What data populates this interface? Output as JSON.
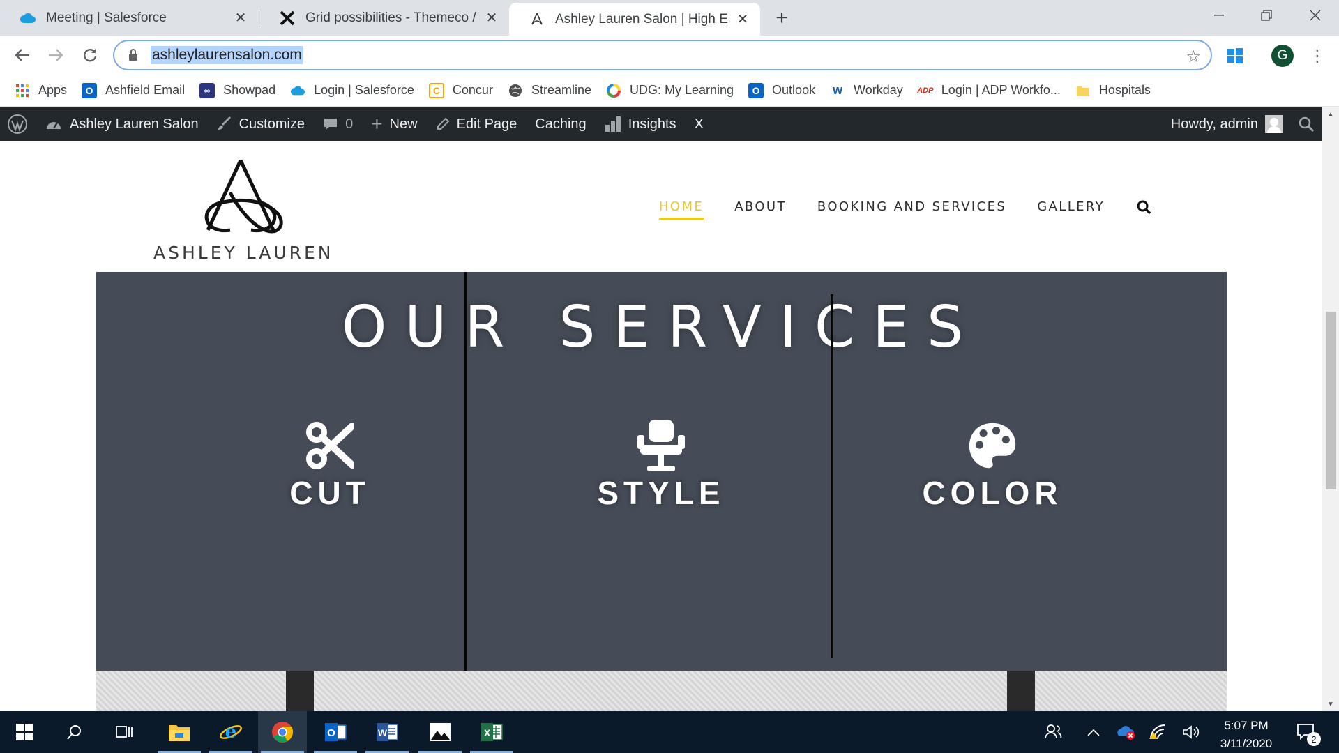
{
  "browser": {
    "tabs": [
      {
        "title": "Meeting | Salesforce",
        "favicon": "salesforce-cloud-icon"
      },
      {
        "title": "Grid possibilities - Themeco / Su",
        "favicon": "themeco-x-icon"
      },
      {
        "title": "Ashley Lauren Salon | High End H",
        "favicon": "ashley-lauren-logo-icon"
      }
    ],
    "url": "ashleylaurensalon.com",
    "profile_initial": "G"
  },
  "bookmarks": [
    {
      "label": "Apps",
      "icon": "apps-grid-icon"
    },
    {
      "label": "Ashfield Email",
      "icon": "outlook-icon",
      "color": "#0a64c8"
    },
    {
      "label": "Showpad",
      "icon": "showpad-icon",
      "color": "#2d3580"
    },
    {
      "label": "Login | Salesforce",
      "icon": "salesforce-cloud-icon",
      "color": "#1a9ee0"
    },
    {
      "label": "Concur",
      "icon": "concur-icon",
      "color": "#f0a500"
    },
    {
      "label": "Streamline",
      "icon": "globe-icon",
      "color": "#4d4d4d"
    },
    {
      "label": "UDG: My Learning",
      "icon": "udg-ring-icon"
    },
    {
      "label": "Outlook",
      "icon": "outlook-icon",
      "color": "#0a64c8"
    },
    {
      "label": "Workday",
      "icon": "workday-icon",
      "color": "#f5a623"
    },
    {
      "label": "Login | ADP Workfo...",
      "icon": "adp-icon",
      "color": "#d0271d"
    },
    {
      "label": "Hospitals",
      "icon": "folder-icon",
      "color": "#f7d460"
    }
  ],
  "adminbar": {
    "site_name": "Ashley Lauren Salon",
    "customize": "Customize",
    "comments_count": "0",
    "new": "New",
    "edit_page": "Edit Page",
    "caching": "Caching",
    "insights": "Insights",
    "x_label": "X",
    "howdy": "Howdy, admin"
  },
  "site": {
    "logo_text": "ASHLEY LAUREN",
    "nav": [
      {
        "label": "HOME",
        "active": true
      },
      {
        "label": "ABOUT",
        "active": false
      },
      {
        "label": "BOOKING AND SERVICES",
        "active": false
      },
      {
        "label": "GALLERY",
        "active": false
      }
    ],
    "accent_color": "#f5c518",
    "services_bg": "#454c57",
    "services_title": "OUR SERVICES",
    "services": [
      {
        "label": "CUT",
        "icon": "scissors-icon"
      },
      {
        "label": "STYLE",
        "icon": "salon-chair-icon"
      },
      {
        "label": "COLOR",
        "icon": "palette-icon"
      }
    ]
  },
  "taskbar": {
    "time": "5:07 PM",
    "date": "3/11/2020",
    "notifications": "2"
  }
}
